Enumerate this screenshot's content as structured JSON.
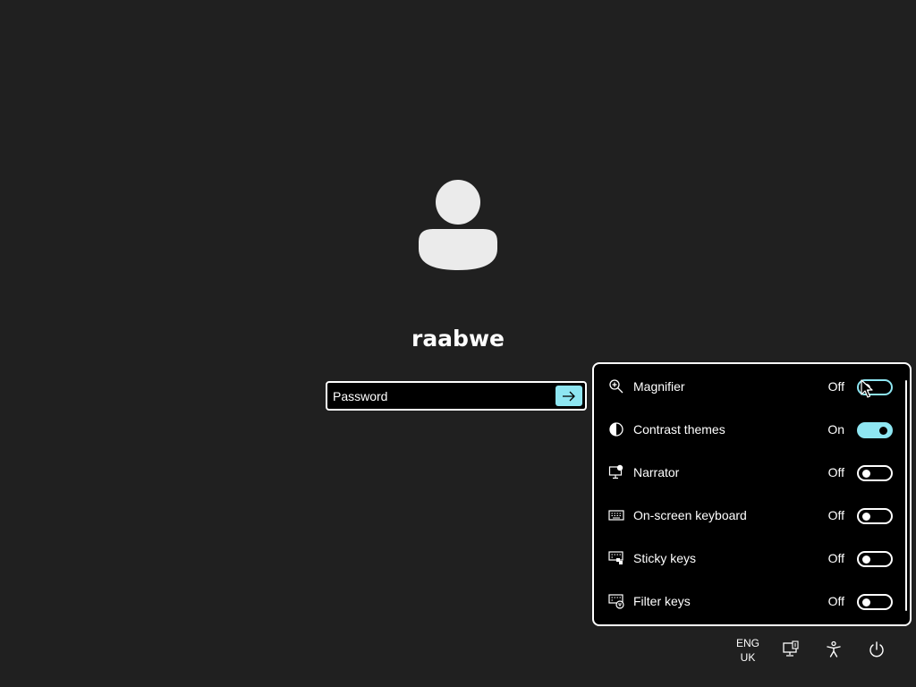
{
  "user": {
    "name": "raabwe"
  },
  "password": {
    "placeholder": "Password",
    "value": ""
  },
  "submit_icon": "arrow-right-icon",
  "accessibility_panel": {
    "items": [
      {
        "label": "Magnifier",
        "state": "Off",
        "on": false,
        "icon": "magnifier-icon"
      },
      {
        "label": "Contrast themes",
        "state": "On",
        "on": true,
        "icon": "contrast-icon"
      },
      {
        "label": "Narrator",
        "state": "Off",
        "on": false,
        "icon": "narrator-icon"
      },
      {
        "label": "On-screen keyboard",
        "state": "Off",
        "on": false,
        "icon": "keyboard-icon"
      },
      {
        "label": "Sticky keys",
        "state": "Off",
        "on": false,
        "icon": "sticky-keys-icon"
      },
      {
        "label": "Filter keys",
        "state": "Off",
        "on": false,
        "icon": "filter-keys-icon"
      }
    ]
  },
  "tray": {
    "language_line1": "ENG",
    "language_line2": "UK",
    "network_icon": "network-icon",
    "accessibility_icon": "accessibility-icon",
    "power_icon": "power-icon"
  },
  "colors": {
    "background": "#202020",
    "accent": "#8ee6f2",
    "panel": "#000000",
    "text": "#ffffff"
  }
}
